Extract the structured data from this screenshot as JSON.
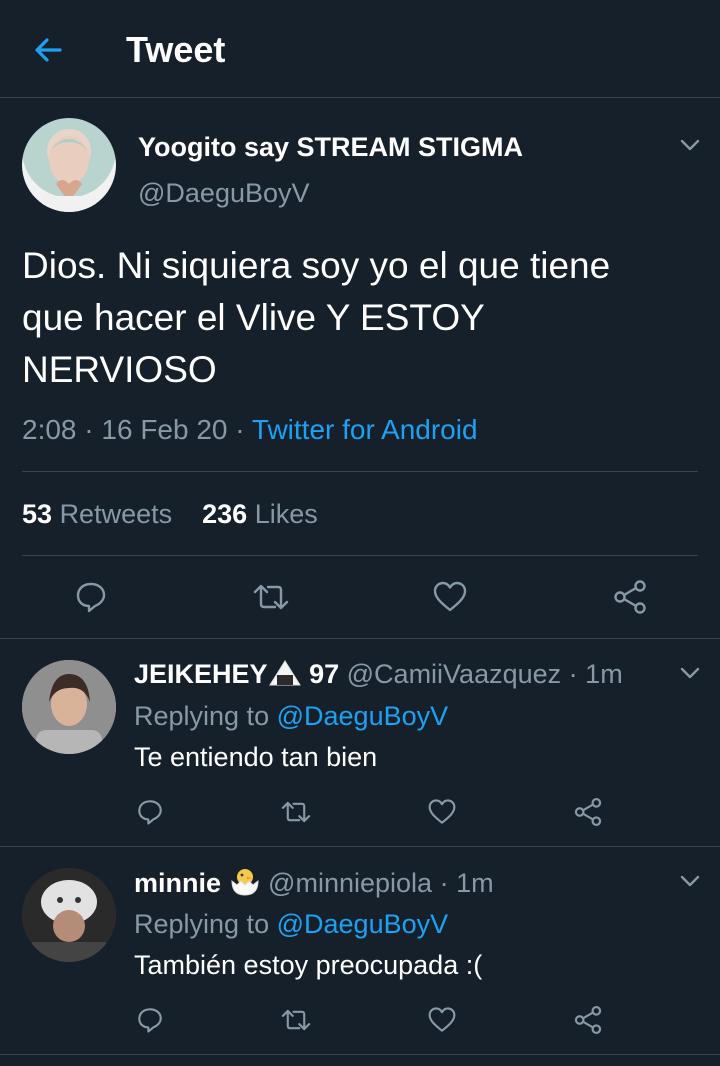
{
  "header": {
    "title": "Tweet",
    "back_icon": "arrow-left-icon"
  },
  "colors": {
    "background": "#15202b",
    "accent": "#1da1f2",
    "muted": "#8899a6",
    "border": "#38444d"
  },
  "tweet": {
    "author_name": "Yoogito say STREAM STIGMA",
    "author_handle": "@DaeguBoyV",
    "text": "Dios. Ni siquiera soy yo el que tiene que hacer el Vlive Y ESTOY NERVIOSO",
    "time": "2:08",
    "date": "16 Feb 20",
    "separator": "·",
    "source": "Twitter for Android",
    "retweets_count": "53",
    "retweets_label": "Retweets",
    "likes_count": "236",
    "likes_label": "Likes"
  },
  "replies": [
    {
      "name": "JEIKEHEY",
      "name_suffix": "97",
      "handle": "@CamiiVaazquez",
      "time": "1m",
      "replying_label": "Replying to",
      "replying_to": "@DaeguBoyV",
      "text": "Te entiendo tan bien"
    },
    {
      "name": "minnie",
      "name_suffix": "",
      "handle": "@minniepiola",
      "time": "1m",
      "replying_label": "Replying to",
      "replying_to": "@DaeguBoyV",
      "text": "También estoy preocupada :("
    }
  ]
}
